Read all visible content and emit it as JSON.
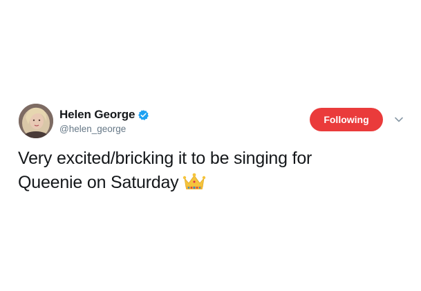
{
  "tweet": {
    "author": {
      "display_name": "Helen George",
      "handle": "@helen_george",
      "verified": true,
      "avatar_icon": "profile-photo"
    },
    "follow_button": {
      "label": "Following",
      "color": "#ea3b3b"
    },
    "menu_icon": "chevron-down-icon",
    "text_line1": "Very excited/bricking it to be singing for",
    "text_line2": "Queenie on Saturday",
    "emoji": "crown",
    "verified_color": "#1da1f2"
  }
}
